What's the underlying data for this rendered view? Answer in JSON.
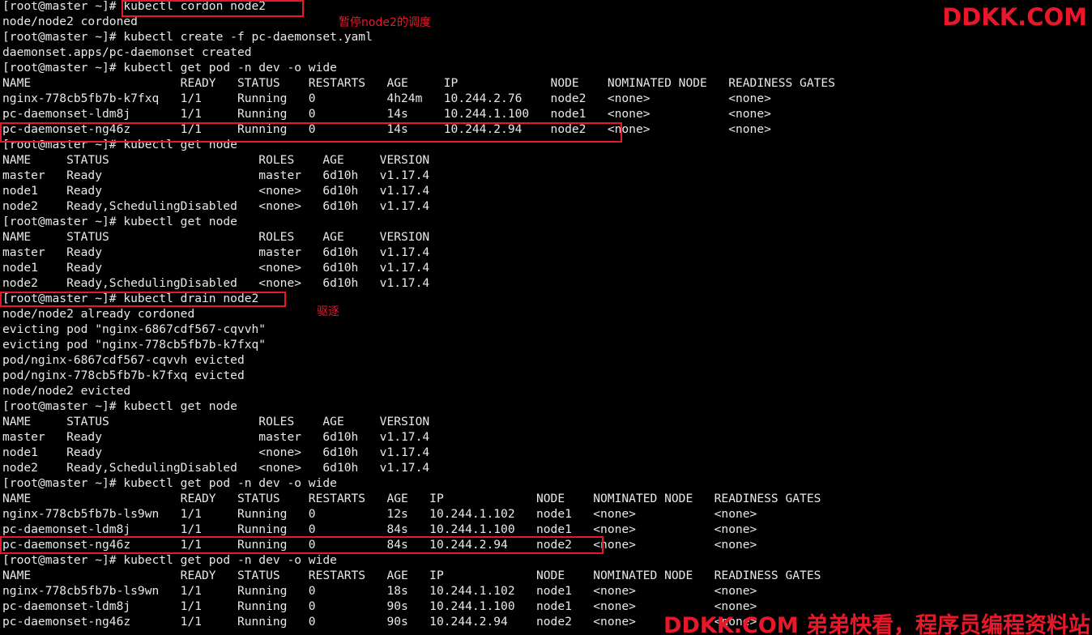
{
  "terminal": {
    "lines": [
      "[root@master ~]# kubectl cordon node2",
      "node/node2 cordoned",
      "[root@master ~]# kubectl create -f pc-daemonset.yaml",
      "daemonset.apps/pc-daemonset created",
      "[root@master ~]# kubectl get pod -n dev -o wide",
      "NAME                     READY   STATUS    RESTARTS   AGE     IP             NODE    NOMINATED NODE   READINESS GATES",
      "nginx-778cb5fb7b-k7fxq   1/1     Running   0          4h24m   10.244.2.76    node2   <none>           <none>",
      "pc-daemonset-ldm8j       1/1     Running   0          14s     10.244.1.100   node1   <none>           <none>",
      "pc-daemonset-ng46z       1/1     Running   0          14s     10.244.2.94    node2   <none>           <none>",
      "[root@master ~]# kubectl get node",
      "NAME     STATUS                     ROLES    AGE     VERSION",
      "master   Ready                      master   6d10h   v1.17.4",
      "node1    Ready                      <none>   6d10h   v1.17.4",
      "node2    Ready,SchedulingDisabled   <none>   6d10h   v1.17.4",
      "[root@master ~]# kubectl get node",
      "NAME     STATUS                     ROLES    AGE     VERSION",
      "master   Ready                      master   6d10h   v1.17.4",
      "node1    Ready                      <none>   6d10h   v1.17.4",
      "node2    Ready,SchedulingDisabled   <none>   6d10h   v1.17.4",
      "[root@master ~]# kubectl drain node2",
      "node/node2 already cordoned",
      "evicting pod \"nginx-6867cdf567-cqvvh\"",
      "evicting pod \"nginx-778cb5fb7b-k7fxq\"",
      "pod/nginx-6867cdf567-cqvvh evicted",
      "pod/nginx-778cb5fb7b-k7fxq evicted",
      "node/node2 evicted",
      "[root@master ~]# kubectl get node",
      "NAME     STATUS                     ROLES    AGE     VERSION",
      "master   Ready                      master   6d10h   v1.17.4",
      "node1    Ready                      <none>   6d10h   v1.17.4",
      "node2    Ready,SchedulingDisabled   <none>   6d10h   v1.17.4",
      "[root@master ~]# kubectl get pod -n dev -o wide",
      "NAME                     READY   STATUS    RESTARTS   AGE   IP             NODE    NOMINATED NODE   READINESS GATES",
      "nginx-778cb5fb7b-ls9wn   1/1     Running   0          12s   10.244.1.102   node1   <none>           <none>",
      "pc-daemonset-ldm8j       1/1     Running   0          84s   10.244.1.100   node1   <none>           <none>",
      "pc-daemonset-ng46z       1/1     Running   0          84s   10.244.2.94    node2   <none>           <none>",
      "[root@master ~]# kubectl get pod -n dev -o wide",
      "NAME                     READY   STATUS    RESTARTS   AGE   IP             NODE    NOMINATED NODE   READINESS GATES",
      "nginx-778cb5fb7b-ls9wn   1/1     Running   0          18s   10.244.1.102   node1   <none>           <none>",
      "pc-daemonset-ldm8j       1/1     Running   0          90s   10.244.1.100   node1   <none>           <none>",
      "pc-daemonset-ng46z       1/1     Running   0          90s   10.244.2.94    node2   <none>           <none>"
    ]
  },
  "annotations": {
    "cordon_note": "暂停node2的调度",
    "drain_note": "驱逐"
  },
  "watermarks": {
    "top": "DDKK.COM",
    "bottom": "DDKK.COM 弟弟快看，程序员编程资料站"
  },
  "colors": {
    "background": "#000000",
    "text": "#e8e8e8",
    "highlight": "#e8182a"
  }
}
